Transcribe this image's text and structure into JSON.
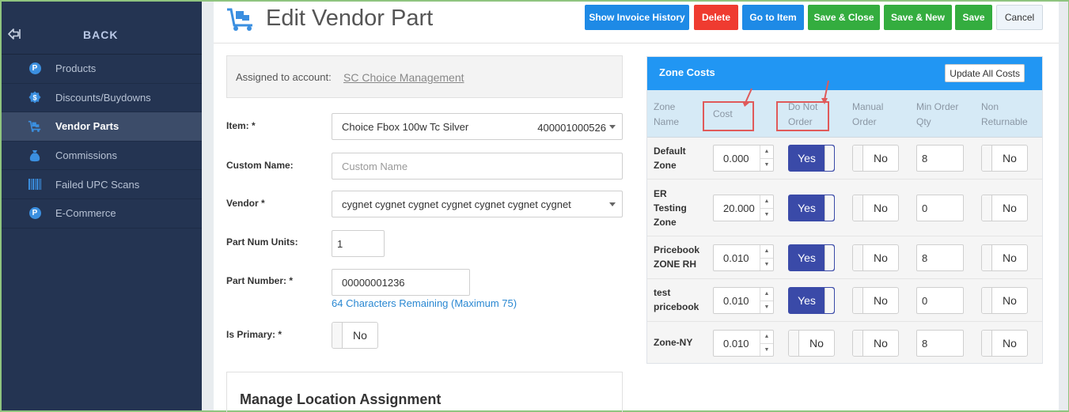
{
  "sidebar": {
    "back_label": "BACK",
    "items": [
      {
        "label": "Products",
        "icon": "product-p-icon",
        "active": false
      },
      {
        "label": "Discounts/Buydowns",
        "icon": "discount-badge-icon",
        "active": false
      },
      {
        "label": "Vendor Parts",
        "icon": "vendor-dolly-icon",
        "active": true
      },
      {
        "label": "Commissions",
        "icon": "money-bag-icon",
        "active": false
      },
      {
        "label": "Failed UPC Scans",
        "icon": "barcode-icon",
        "active": false
      },
      {
        "label": "E-Commerce",
        "icon": "ecommerce-p-icon",
        "active": false
      }
    ]
  },
  "header": {
    "title": "Edit Vendor Part",
    "buttons": {
      "show_invoice_history": "Show Invoice History",
      "delete": "Delete",
      "go_to_item": "Go to Item",
      "save_close": "Save & Close",
      "save_new": "Save & New",
      "save": "Save",
      "cancel": "Cancel"
    }
  },
  "form": {
    "account_label": "Assigned to account:",
    "account_value": "SC Choice Management",
    "item_label": "Item: *",
    "item_value": "Choice Fbox 100w Tc Silver",
    "item_code": "400001000526",
    "custom_name_label": "Custom Name:",
    "custom_name_placeholder": "Custom Name",
    "vendor_label": "Vendor *",
    "vendor_value": "cygnet cygnet cygnet cygnet cygnet cygnet cygnet",
    "part_num_units_label": "Part Num Units:",
    "part_num_units_value": "1",
    "part_number_label": "Part Number: *",
    "part_number_value": "00000001236",
    "part_number_helper": "64 Characters Remaining (Maximum 75)",
    "is_primary_label": "Is Primary: *",
    "is_primary_value": "No",
    "manage_title": "Manage Location Assignment"
  },
  "zones": {
    "title": "Zone Costs",
    "update_all_label": "Update All Costs",
    "columns": {
      "zone_name": "Zone Name",
      "cost": "Cost",
      "do_not_order": "Do Not Order",
      "manual_order": "Manual Order",
      "min_order_qty": "Min Order Qty",
      "non_returnable": "Non Returnable"
    },
    "rows": [
      {
        "name": "Default Zone",
        "cost": "0.000",
        "do_not_order": "Yes",
        "manual_order": "No",
        "min_qty": "8",
        "non_returnable": "No"
      },
      {
        "name": "ER Testing Zone",
        "cost": "20.000",
        "do_not_order": "Yes",
        "manual_order": "No",
        "min_qty": "0",
        "non_returnable": "No"
      },
      {
        "name": "Pricebook ZONE RH",
        "cost": "0.010",
        "do_not_order": "Yes",
        "manual_order": "No",
        "min_qty": "8",
        "non_returnable": "No"
      },
      {
        "name": "test pricebook",
        "cost": "0.010",
        "do_not_order": "Yes",
        "manual_order": "No",
        "min_qty": "0",
        "non_returnable": "No"
      },
      {
        "name": "Zone-NY",
        "cost": "0.010",
        "do_not_order": "No",
        "manual_order": "No",
        "min_qty": "8",
        "non_returnable": "No"
      }
    ]
  },
  "colors": {
    "sidebar_bg": "#243452",
    "primary_blue": "#1e8ae6",
    "danger_red": "#ef3b30",
    "success_green": "#34ad3f",
    "toggle_yes": "#3a4aa8",
    "annotation_red": "#e05a5a"
  }
}
